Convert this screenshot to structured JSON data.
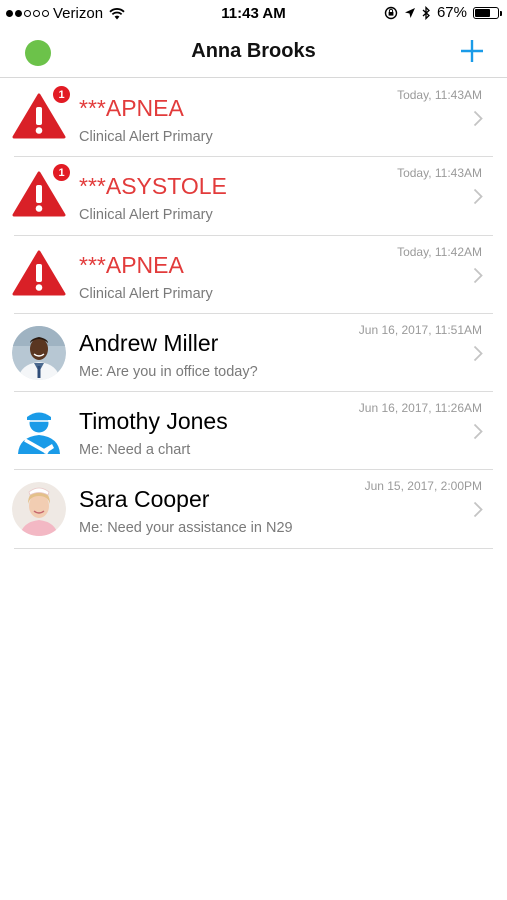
{
  "status_bar": {
    "carrier": "Verizon",
    "time": "11:43 AM",
    "battery": "67%",
    "battery_level": 0.67,
    "signal_bars": 2,
    "icons": [
      "wifi-icon",
      "rotation-lock-icon",
      "location-icon",
      "bluetooth-icon",
      "battery-icon"
    ]
  },
  "nav": {
    "title": "Anna Brooks",
    "presence_color": "#6cc24a",
    "add_icon": "plus-icon",
    "accent_color": "#1a9be8"
  },
  "conversations": [
    {
      "kind": "alert",
      "title": "***APNEA",
      "subtitle": "Clinical Alert Primary",
      "time": "Today, 11:43AM",
      "badge": "1"
    },
    {
      "kind": "alert",
      "title": "***ASYSTOLE",
      "subtitle": "Clinical Alert Primary",
      "time": "Today, 11:43AM",
      "badge": "1"
    },
    {
      "kind": "alert",
      "title": "***APNEA",
      "subtitle": "Clinical Alert Primary",
      "time": "Today, 11:42AM",
      "badge": ""
    },
    {
      "kind": "contact",
      "title": "Andrew Miller",
      "subtitle": "Me: Are you in office today?",
      "time": "Jun 16, 2017, 11:51AM",
      "avatar": "doctor-photo"
    },
    {
      "kind": "contact",
      "title": "Timothy Jones",
      "subtitle": "Me: Need a chart",
      "time": "Jun 16, 2017, 11:26AM",
      "avatar": "patient-icon"
    },
    {
      "kind": "contact",
      "title": "Sara Cooper",
      "subtitle": "Me: Need your assistance in N29",
      "time": "Jun 15, 2017, 2:00PM",
      "avatar": "nurse-photo"
    }
  ],
  "colors": {
    "alert_red": "#e23b3b",
    "badge_red": "#e21b24",
    "icon_blue": "#1a9be8"
  }
}
